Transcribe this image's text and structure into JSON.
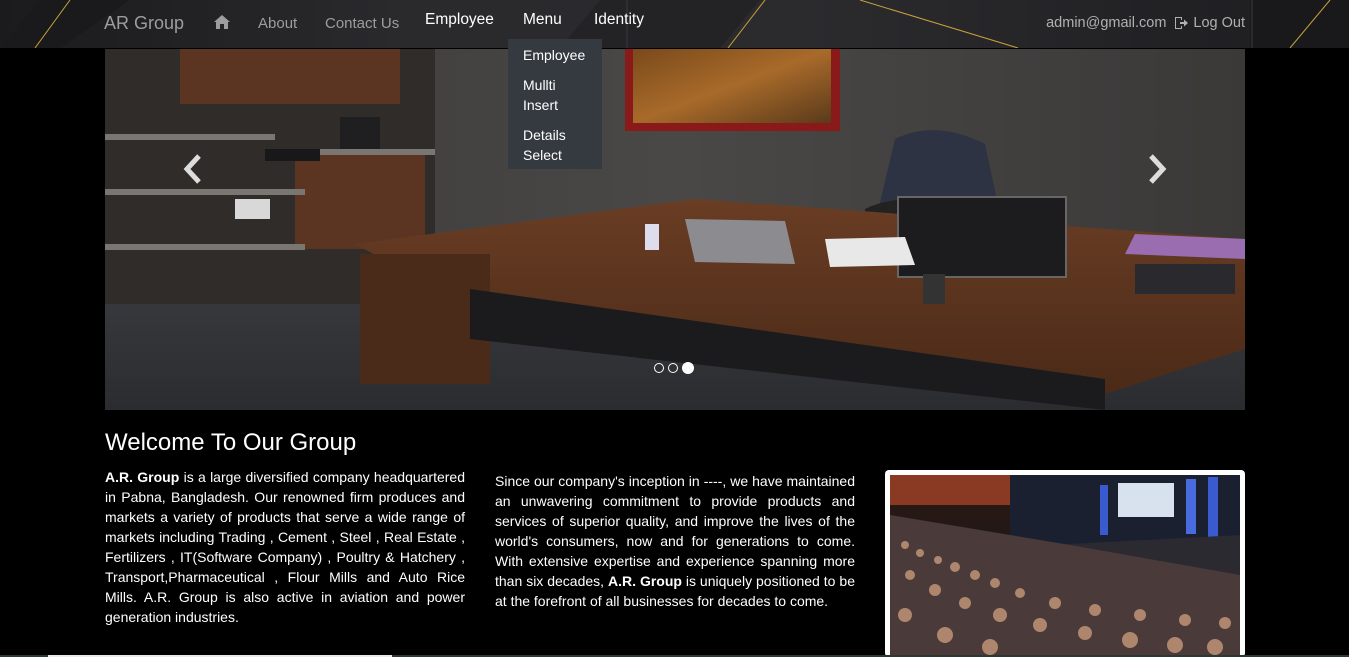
{
  "navbar": {
    "brand": "AR Group",
    "links": [
      {
        "label": "About"
      },
      {
        "label": "Contact Us"
      },
      {
        "label": "Employee"
      },
      {
        "label": "Menu"
      },
      {
        "label": "Identity"
      }
    ],
    "user_email": "admin@gmail.com",
    "logout_label": "Log Out"
  },
  "dropdown": {
    "items": [
      {
        "label": "Employee"
      },
      {
        "label": "Mullti Insert"
      },
      {
        "label": "Details Select"
      }
    ]
  },
  "carousel": {
    "slide_count": 3,
    "active_index": 2
  },
  "content": {
    "heading": "Welcome To Our Group",
    "col1_strong": "A.R. Group",
    "col1_text": " is a large diversified company headquartered in Pabna, Bangladesh. Our renowned firm produces and markets a variety of products that serve a wide range of markets including Trading , Cement , Steel , Real Estate , Fertilizers , IT(Software Company) , Poultry & Hatchery , Transport,Pharmaceutical , Flour Mills and Auto Rice Mills. A.R. Group is also active in aviation and power generation industries.",
    "col2_text_a": "Since our company's inception in ----, we have maintained an unwavering commitment to provide products and services of superior quality, and improve the lives of the world's consumers, now and for generations to come. With extensive expertise and experience spanning more than six decades, ",
    "col2_strong": "A.R. Group",
    "col2_text_b": " is uniquely positioned to be at the forefront of all businesses for decades to come."
  },
  "colors": {
    "navbar_bg": "#2a2a2d",
    "dropdown_bg": "#343a40",
    "page_bg": "#000000",
    "nav_muted": "#9d9d9d"
  },
  "icons": [
    "home-icon",
    "logout-icon",
    "chevron-left-icon",
    "chevron-right-icon"
  ]
}
